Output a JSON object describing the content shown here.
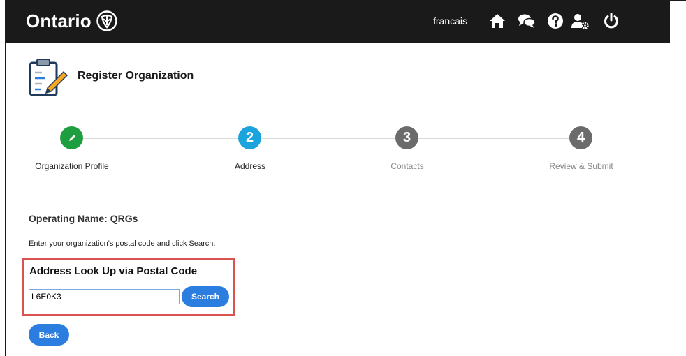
{
  "header": {
    "brand": "Ontario",
    "language_link": "francais",
    "icons": [
      "home-icon",
      "chat-icon",
      "help-icon",
      "user-settings-icon",
      "power-icon"
    ],
    "background": "#1a1a1a"
  },
  "page": {
    "title": "Register Organization"
  },
  "steps": [
    {
      "number": "",
      "label": "Organization Profile",
      "status": "completed",
      "color": "#1e9e3e"
    },
    {
      "number": "2",
      "label": "Address",
      "status": "current",
      "color": "#1aa3dc"
    },
    {
      "number": "3",
      "label": "Contacts",
      "status": "pending",
      "color": "#6b6b6b"
    },
    {
      "number": "4",
      "label": "Review & Submit",
      "status": "pending",
      "color": "#6b6b6b"
    }
  ],
  "form": {
    "operating_name": "Operating Name: QRGs",
    "instructions": "Enter your organization's postal code and click Search.",
    "lookup_title": "Address Look Up via Postal Code",
    "postal_code_value": "L6E0K3",
    "search_label": "Search",
    "back_label": "Back",
    "highlight_color": "#d9534f",
    "button_color": "#2b7de0"
  }
}
